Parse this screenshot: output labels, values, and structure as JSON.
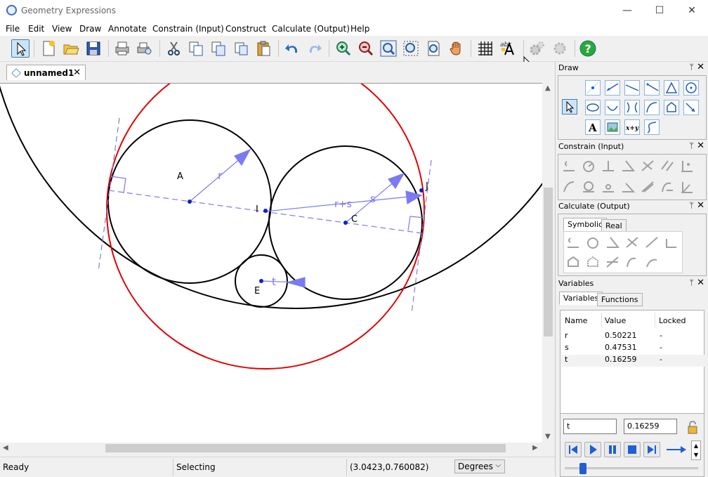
{
  "window": {
    "title": "Geometry Expressions",
    "min_glyph": "—",
    "max_glyph": "☐",
    "close_glyph": "✕"
  },
  "menu": [
    "File",
    "Edit",
    "View",
    "Draw",
    "Annotate",
    "Constrain (Input)",
    "Construct",
    "Calculate (Output)",
    "Help"
  ],
  "toolbar": [
    "select",
    "new",
    "open",
    "save",
    "print",
    "print-preview",
    "cut",
    "copy",
    "copy-special",
    "paste-special",
    "paste",
    "undo",
    "redo",
    "zoom-in",
    "zoom-out",
    "zoom-fit",
    "zoom-window",
    "zoom-page",
    "pan",
    "grid",
    "font",
    "gear",
    "gear-2",
    "help"
  ],
  "document": {
    "tab_title": "unnamed1",
    "tab_close": "✕"
  },
  "drawing": {
    "labels": {
      "A": "A",
      "I": "I",
      "C": "C",
      "E": "E",
      "J": "J",
      "r": "r",
      "s": "s",
      "rs": "r+s",
      "t": "t"
    },
    "colors": {
      "circle": "#000000",
      "outer_circle": "#e00000",
      "construction": "#7b7bef",
      "point": "#1020d0"
    }
  },
  "status": {
    "ready": "Ready",
    "mode": "Selecting",
    "coords": "(3.0423,0.760082)",
    "units": "Degrees"
  },
  "panels": {
    "draw": "Draw",
    "constrain": "Constrain (Input)",
    "calculate": "Calculate (Output)",
    "calc_tabs": [
      "Symbolic",
      "Real"
    ],
    "variables": "Variables",
    "var_tabs": [
      "Variables",
      "Functions"
    ],
    "pin_glyph": "ᛘ",
    "close_glyph": "✕"
  },
  "variables": {
    "headers": [
      "Name",
      "Value",
      "Locked"
    ],
    "rows": [
      {
        "name": "r",
        "value": "0.50221",
        "locked": "-"
      },
      {
        "name": "s",
        "value": "0.47531",
        "locked": "-"
      },
      {
        "name": "t",
        "value": "0.16259",
        "locked": "-"
      }
    ],
    "selected_name": "t",
    "selected_value": "0.16259"
  }
}
